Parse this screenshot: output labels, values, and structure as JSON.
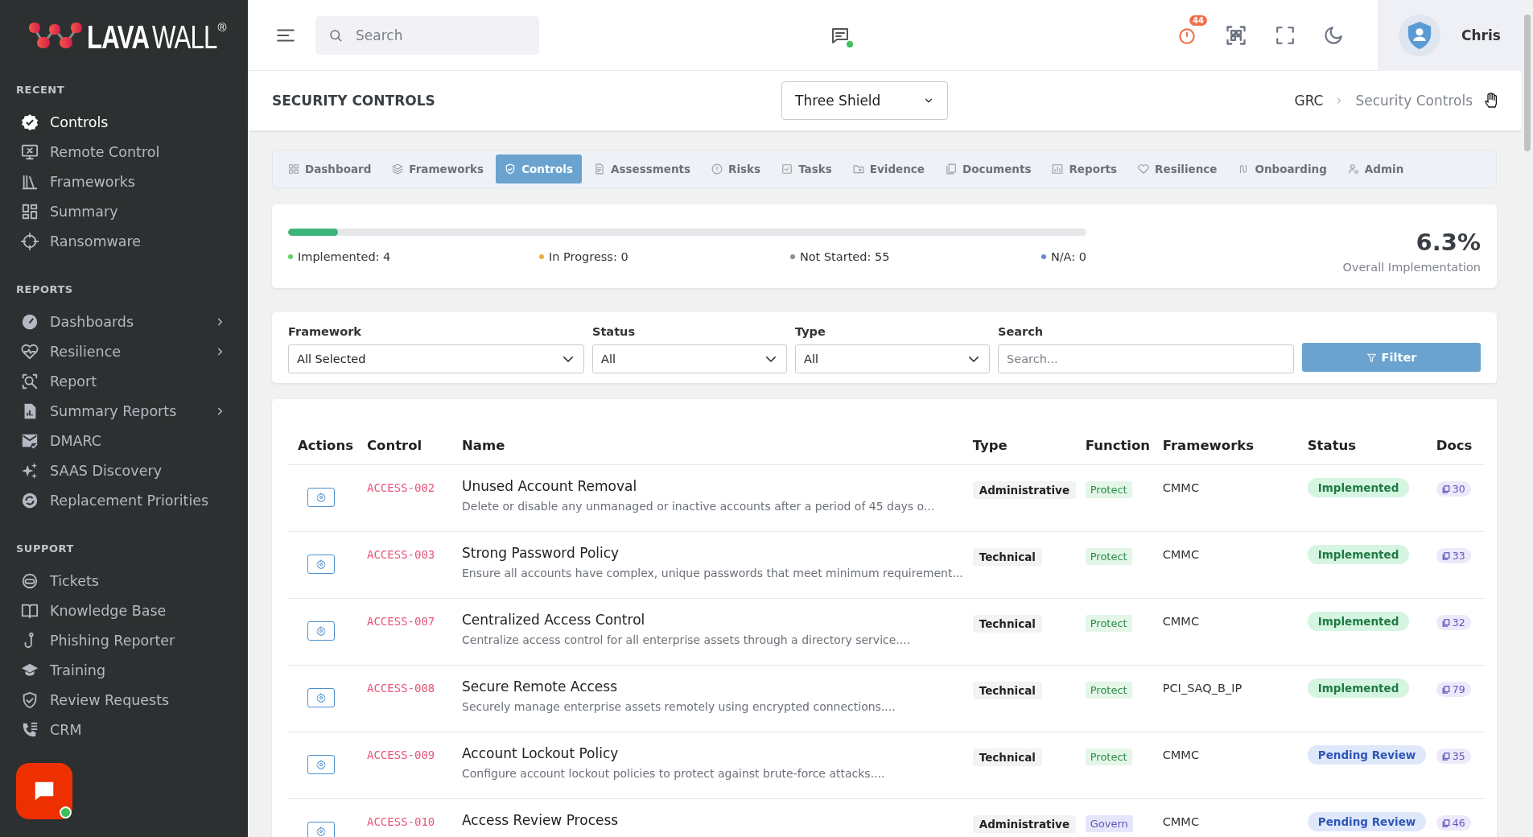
{
  "logo": {
    "bold": "LAVA",
    "light": "WALL",
    "mark": "®"
  },
  "sidebar": {
    "sections": [
      {
        "title": "RECENT",
        "items": [
          {
            "label": "Controls",
            "selected": true
          },
          {
            "label": "Remote Control",
            "selected": false
          },
          {
            "label": "Frameworks",
            "selected": false
          },
          {
            "label": "Summary",
            "selected": false
          },
          {
            "label": "Ransomware",
            "selected": false
          }
        ]
      },
      {
        "title": "REPORTS",
        "items": [
          {
            "label": "Dashboards",
            "selected": false,
            "expanded": false
          },
          {
            "label": "Resilience",
            "selected": false,
            "expanded": false
          },
          {
            "label": "Report",
            "selected": false
          },
          {
            "label": "Summary Reports",
            "selected": false,
            "expanded": false
          },
          {
            "label": "DMARC",
            "selected": false
          },
          {
            "label": "SAAS Discovery",
            "selected": false
          },
          {
            "label": "Replacement Priorities",
            "selected": false
          }
        ]
      },
      {
        "title": "SUPPORT",
        "items": [
          {
            "label": "Tickets",
            "selected": false
          },
          {
            "label": "Knowledge Base",
            "selected": false
          },
          {
            "label": "Phishing Reporter",
            "selected": false
          },
          {
            "label": "Training",
            "selected": false
          },
          {
            "label": "Review Requests",
            "selected": false
          },
          {
            "label": "CRM",
            "selected": false
          }
        ]
      }
    ],
    "chat_widget": {
      "online": true
    }
  },
  "header": {
    "search": {
      "placeholder": "Search"
    },
    "messages": {
      "online": true
    },
    "notifications": {
      "count": "44"
    },
    "user": {
      "name": "Chris"
    }
  },
  "title_bar": {
    "title": "SECURITY CONTROLS",
    "organization": "Three Shield",
    "breadcrumb": [
      "GRC",
      "Security Controls"
    ]
  },
  "tabs": [
    {
      "label": "Dashboard",
      "selected": false
    },
    {
      "label": "Frameworks",
      "selected": false
    },
    {
      "label": "Controls",
      "selected": true
    },
    {
      "label": "Assessments",
      "selected": false
    },
    {
      "label": "Risks",
      "selected": false
    },
    {
      "label": "Tasks",
      "selected": false
    },
    {
      "label": "Evidence",
      "selected": false
    },
    {
      "label": "Documents",
      "selected": false
    },
    {
      "label": "Reports",
      "selected": false
    },
    {
      "label": "Resilience",
      "selected": false
    },
    {
      "label": "Onboarding",
      "selected": false
    },
    {
      "label": "Admin",
      "selected": false
    }
  ],
  "progress": {
    "level": 0.063,
    "percent": "6.3%",
    "caption": "Overall Implementation",
    "legend": [
      {
        "label": "Implemented: 4",
        "color": "#5fcf6f"
      },
      {
        "label": "In Progress: 0",
        "color": "#f0ad3c"
      },
      {
        "label": "Not Started: 55",
        "color": "#8a8f98"
      },
      {
        "label": "N/A: 0",
        "color": "#6a86d8"
      }
    ]
  },
  "filters": {
    "fields": [
      {
        "label": "Framework",
        "value": "All Selected",
        "kind": "select"
      },
      {
        "label": "Status",
        "value": "All",
        "kind": "select"
      },
      {
        "label": "Type",
        "value": "All",
        "kind": "select"
      },
      {
        "label": "Search",
        "placeholder": "Search...",
        "kind": "text"
      }
    ],
    "button": "Filter"
  },
  "table": {
    "columns": [
      "Actions",
      "Control",
      "Name",
      "Type",
      "Function",
      "Frameworks",
      "Status",
      "Docs"
    ],
    "rows": [
      {
        "control": "ACCESS-002",
        "name": "Unused Account Removal",
        "description": "Delete or disable any unmanaged or inactive accounts after a period of 45 days o...",
        "type": "Administrative",
        "function": {
          "label": "Protect",
          "kind": "protect"
        },
        "framework": "CMMC",
        "status": {
          "label": "Implemented",
          "kind": "implemented"
        },
        "docs": "30"
      },
      {
        "control": "ACCESS-003",
        "name": "Strong Password Policy",
        "description": "Ensure all accounts have complex, unique passwords that meet minimum requirement...",
        "type": "Technical",
        "function": {
          "label": "Protect",
          "kind": "protect"
        },
        "framework": "CMMC",
        "status": {
          "label": "Implemented",
          "kind": "implemented"
        },
        "docs": "33"
      },
      {
        "control": "ACCESS-007",
        "name": "Centralized Access Control",
        "description": "Centralize access control for all enterprise assets through a directory service....",
        "type": "Technical",
        "function": {
          "label": "Protect",
          "kind": "protect"
        },
        "framework": "CMMC",
        "status": {
          "label": "Implemented",
          "kind": "implemented"
        },
        "docs": "32"
      },
      {
        "control": "ACCESS-008",
        "name": "Secure Remote Access",
        "description": "Securely manage enterprise assets remotely using encrypted connections....",
        "type": "Technical",
        "function": {
          "label": "Protect",
          "kind": "protect"
        },
        "framework": "PCI_SAQ_B_IP",
        "status": {
          "label": "Implemented",
          "kind": "implemented"
        },
        "docs": "79"
      },
      {
        "control": "ACCESS-009",
        "name": "Account Lockout Policy",
        "description": "Configure account lockout policies to protect against brute-force attacks....",
        "type": "Technical",
        "function": {
          "label": "Protect",
          "kind": "protect"
        },
        "framework": "CMMC",
        "status": {
          "label": "Pending Review",
          "kind": "pending"
        },
        "docs": "35"
      },
      {
        "control": "ACCESS-010",
        "name": "Access Review Process",
        "type": "Administrative",
        "function": {
          "label": "Govern",
          "kind": "govern"
        },
        "framework": "CMMC",
        "status": {
          "label": "Pending Review",
          "kind": "pending"
        },
        "docs": "46"
      }
    ]
  }
}
